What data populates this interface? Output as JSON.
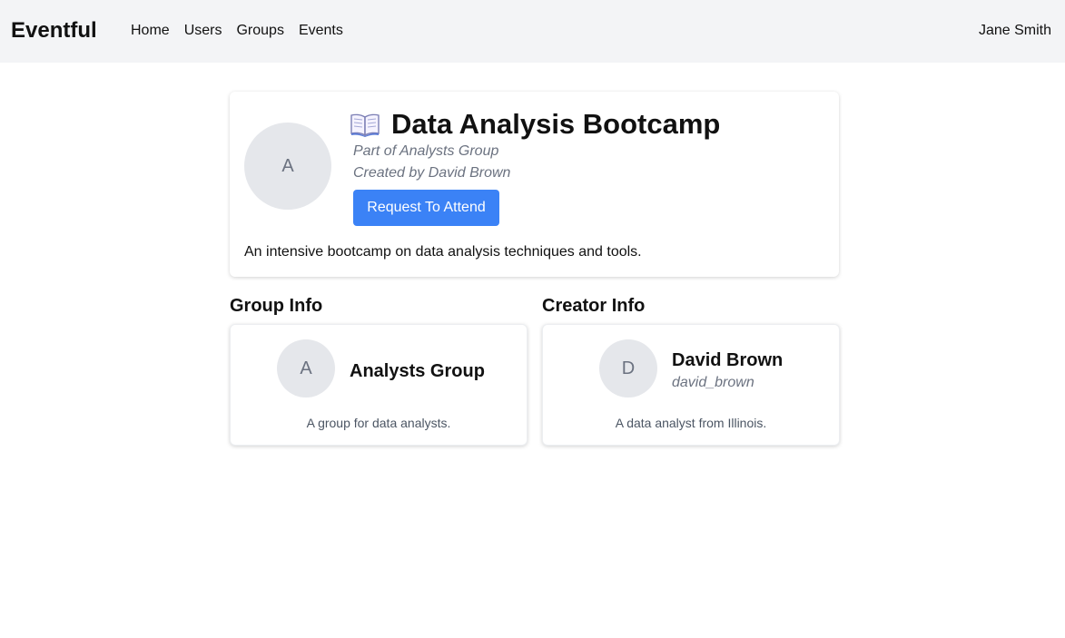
{
  "nav": {
    "brand": "Eventful",
    "links": [
      "Home",
      "Users",
      "Groups",
      "Events"
    ],
    "user": "Jane Smith"
  },
  "event": {
    "avatar_letter": "A",
    "icon": "open-book-icon",
    "title": "Data Analysis Bootcamp",
    "group_line": "Part of Analysts Group",
    "creator_line": "Created by David Brown",
    "attend_button": "Request To Attend",
    "description": "An intensive bootcamp on data analysis techniques and tools."
  },
  "group_info": {
    "heading": "Group Info",
    "avatar_letter": "A",
    "name": "Analysts Group",
    "description": "A group for data analysts."
  },
  "creator_info": {
    "heading": "Creator Info",
    "avatar_letter": "D",
    "name": "David Brown",
    "username": "david_brown",
    "description": "A data analyst from Illinois."
  },
  "colors": {
    "nav_bg": "#f3f4f6",
    "button": "#3b82f6",
    "avatar_bg": "#e5e7eb",
    "muted_text": "#6b7280"
  }
}
